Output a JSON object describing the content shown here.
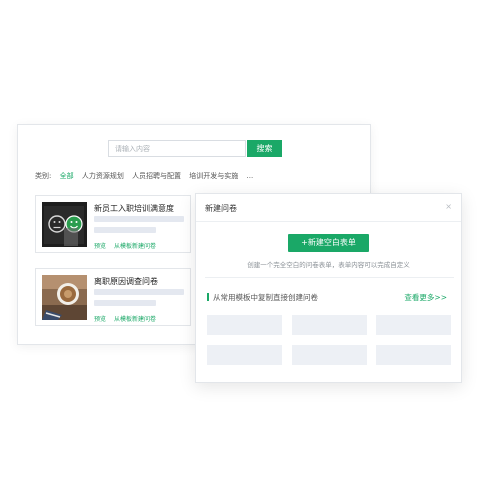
{
  "search": {
    "placeholder": "请输入内容",
    "button_label": "搜索"
  },
  "categories": {
    "label": "类别:",
    "items": [
      "全部",
      "人力资源规划",
      "人员招聘与配置",
      "培训开发与实施",
      "..."
    ],
    "active": "全部"
  },
  "cards": [
    {
      "title": "新员工入职培训满意度",
      "links": [
        "预览",
        "从模板新建问卷"
      ]
    },
    {
      "title": "离职原因调查问卷",
      "links": [
        "预览",
        "从模板新建问卷"
      ]
    }
  ],
  "modal": {
    "title": "新建问卷",
    "close_icon": "×",
    "create_button": "+新建空白表单",
    "create_desc": "创建一个完全空白的问卷表单，表单内容可以完成自定义",
    "section_label": "从常用模板中复制直接创建问卷",
    "see_more": "查看更多>>"
  },
  "colors": {
    "accent": "#1aa867",
    "placeholder": "#e4e8f0",
    "border": "#e3e6ea"
  }
}
